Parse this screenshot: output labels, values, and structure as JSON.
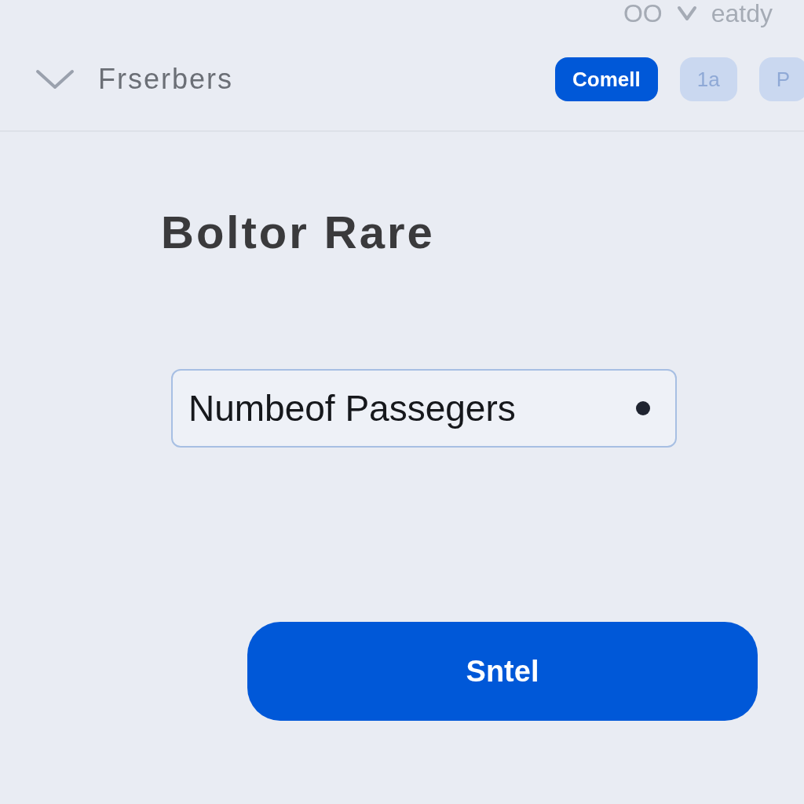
{
  "top_strip": {
    "texts": [
      "OO",
      "eatdy"
    ]
  },
  "header": {
    "title": "Frserbers",
    "expanded": true,
    "pills": [
      {
        "label": "Comell",
        "selected": true
      },
      {
        "label": "1a",
        "selected": false
      },
      {
        "label": "P",
        "selected": false
      }
    ]
  },
  "form": {
    "title": "Boltor Rare",
    "field": {
      "value": "Numbeof Passegers"
    },
    "button": "Sntel"
  }
}
